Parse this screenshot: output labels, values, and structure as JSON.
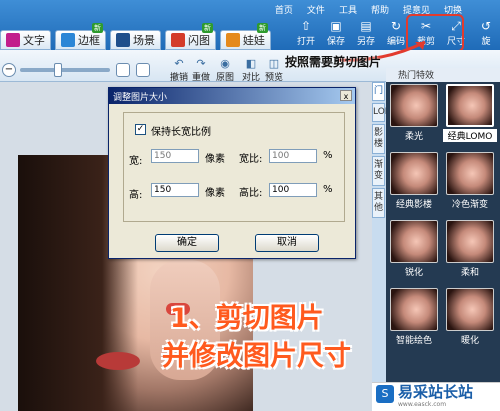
{
  "menu": [
    "首页",
    "文件",
    "工具",
    "帮助",
    "提意见",
    "切换"
  ],
  "tabs": [
    {
      "label": "文字",
      "color": "#c21e8c",
      "new": false
    },
    {
      "label": "边框",
      "color": "#2b86d6",
      "new": true
    },
    {
      "label": "场景",
      "color": "#1f4f8b",
      "new": false
    },
    {
      "label": "闪图",
      "color": "#d43c2a",
      "new": true
    },
    {
      "label": "娃娃",
      "color": "#e58a1d",
      "new": true
    }
  ],
  "new_badge": "新",
  "toolbar": [
    {
      "label": "打开",
      "icon": "open-icon",
      "glyph": "⇧"
    },
    {
      "label": "保存",
      "icon": "save-icon",
      "glyph": "▣"
    },
    {
      "label": "另存",
      "icon": "save-as-icon",
      "glyph": "▤"
    },
    {
      "label": "编码",
      "icon": "refresh-icon",
      "glyph": "↻"
    },
    {
      "label": "裁剪",
      "icon": "scissors-icon",
      "glyph": "✂"
    },
    {
      "label": "尺寸",
      "icon": "resize-icon",
      "glyph": "⤢"
    },
    {
      "label": "旋",
      "icon": "rotate-icon",
      "glyph": "↺"
    }
  ],
  "edit_tools": [
    {
      "label": "撤销",
      "glyph": "↶"
    },
    {
      "label": "重做",
      "glyph": "↷"
    },
    {
      "label": "原图",
      "glyph": "◉"
    },
    {
      "label": "对比",
      "glyph": "◧"
    },
    {
      "label": "预览",
      "glyph": "◫"
    }
  ],
  "hint_text": "按照需要剪切图片",
  "dialog": {
    "title": "调整图片大小",
    "close": "x",
    "keep_ratio_label": "保持长宽比例",
    "keep_ratio_checked": "✓",
    "width_label": "宽:",
    "width_value": "150",
    "width_unit": "像素",
    "width_ratio_label": "宽比:",
    "width_ratio_value": "100",
    "height_label": "高:",
    "height_value": "150",
    "height_unit": "像素",
    "height_ratio_label": "高比:",
    "height_ratio_value": "100",
    "percent": "%",
    "ok": "确定",
    "cancel": "取消"
  },
  "side_tabs": [
    "门",
    "LOMO",
    "影楼",
    "渐变",
    "其他"
  ],
  "gallery_header": "热门特效",
  "gallery": [
    {
      "label": "柔光"
    },
    {
      "label": "经典LOMO"
    },
    {
      "label": "经典影楼"
    },
    {
      "label": "冷色渐变"
    },
    {
      "label": "锐化"
    },
    {
      "label": "柔和"
    },
    {
      "label": "智能绘色"
    },
    {
      "label": "暖化"
    }
  ],
  "overlay_text": [
    "1、剪切图片",
    "并修改图片尺寸"
  ],
  "watermark": {
    "icon": "S",
    "title": "易采站长站",
    "subtitle": "www.easck.com"
  }
}
